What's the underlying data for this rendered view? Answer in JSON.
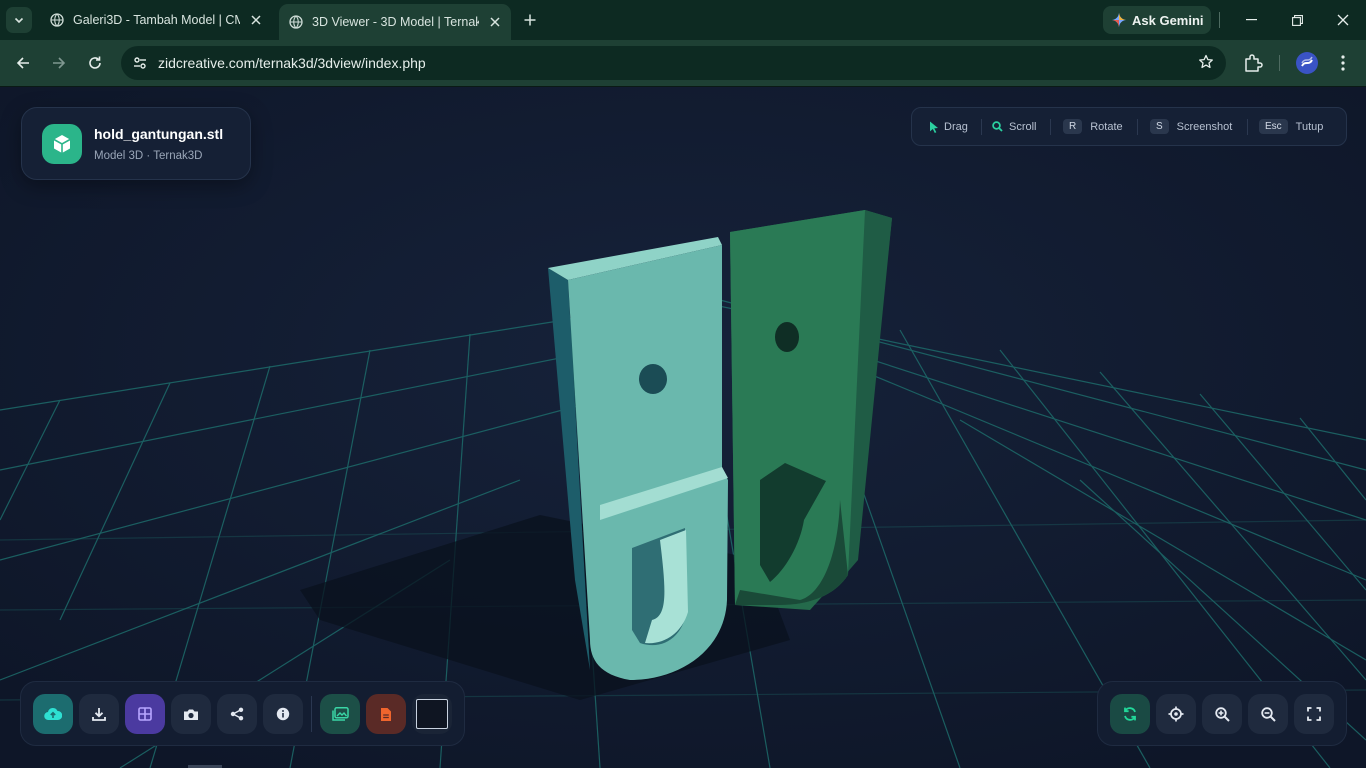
{
  "browser": {
    "tabs": [
      {
        "title": "Galeri3D - Tambah Model | CMS",
        "active": false
      },
      {
        "title": "3D Viewer - 3D Model | Ternak3D",
        "active": true
      }
    ],
    "ask_gemini": "Ask Gemini",
    "url": "zidcreative.com/ternak3d/3dview/index.php"
  },
  "model": {
    "filename": "hold_gantungan.stl",
    "subtitle": "Model 3D · Ternak3D"
  },
  "hints": [
    {
      "key": "",
      "label": "Drag"
    },
    {
      "key": "",
      "label": "Scroll"
    },
    {
      "key": "R",
      "label": "Rotate"
    },
    {
      "key": "S",
      "label": "Screenshot"
    },
    {
      "key": "Esc",
      "label": "Tutup"
    }
  ],
  "toolbar_left": [
    {
      "name": "upload",
      "icon": "cloud-upload-icon",
      "color": "#2bb0b8"
    },
    {
      "name": "download",
      "icon": "download-icon"
    },
    {
      "name": "grid",
      "icon": "grid-icon",
      "color": "#6a4fd6"
    },
    {
      "name": "screenshot",
      "icon": "camera-icon"
    },
    {
      "name": "share",
      "icon": "share-icon"
    },
    {
      "name": "info",
      "icon": "info-icon"
    },
    {
      "name": "background",
      "icon": "image-icon",
      "color": "#1f6b58"
    },
    {
      "name": "pdf",
      "icon": "document-icon",
      "color": "#e2552a"
    },
    {
      "name": "color",
      "icon": "color-swatch-icon"
    }
  ],
  "toolbar_right": [
    {
      "name": "auto-rotate",
      "icon": "refresh-icon",
      "color": "#20c48e"
    },
    {
      "name": "center",
      "icon": "crosshair-icon"
    },
    {
      "name": "zoom-in",
      "icon": "zoom-in-icon"
    },
    {
      "name": "zoom-out",
      "icon": "zoom-out-icon"
    },
    {
      "name": "fullscreen",
      "icon": "fullscreen-icon"
    }
  ],
  "colors": {
    "accent": "#2bb58a",
    "part_light": "#6ab8ad",
    "part_dark": "#2a7a55",
    "grid": "#1f6d6b"
  }
}
